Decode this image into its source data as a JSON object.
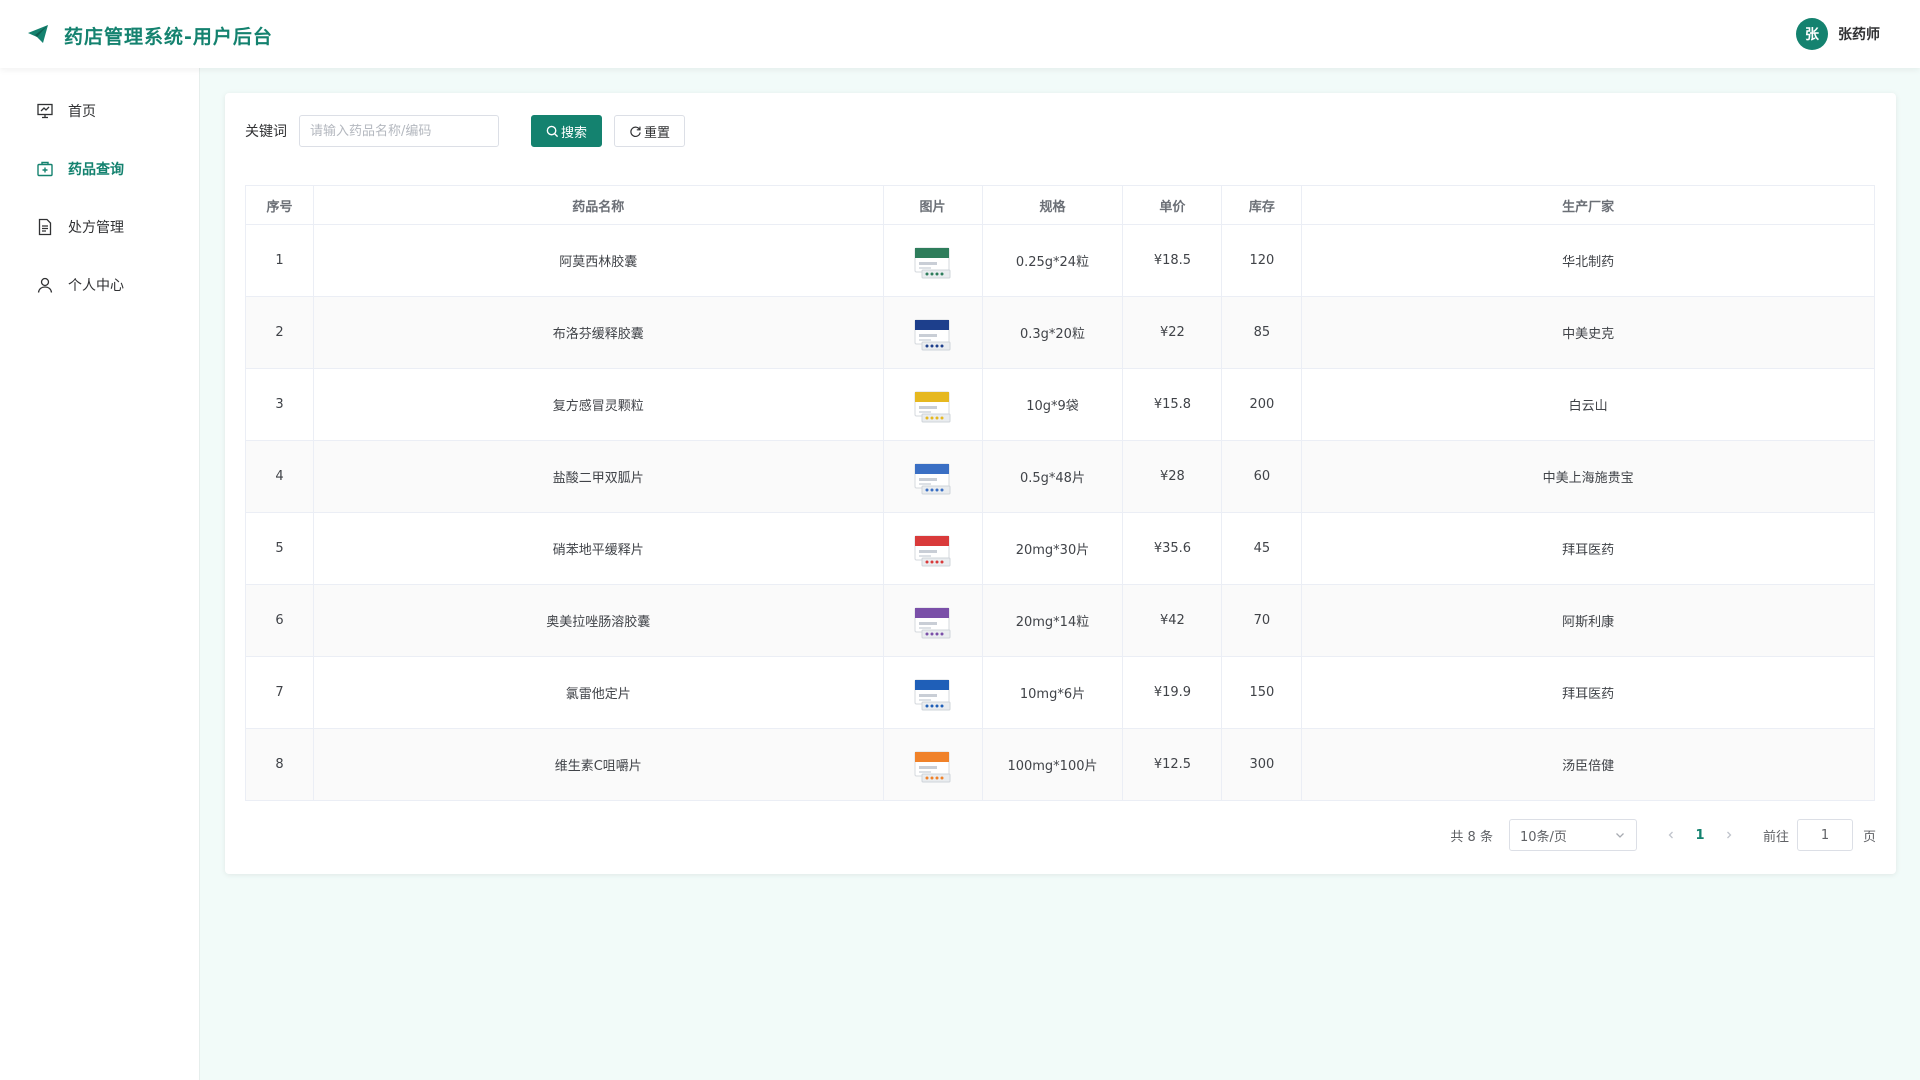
{
  "header": {
    "title": "药店管理系统-用户后台",
    "logo_icon": "paper-plane-icon",
    "user": {
      "avatar_text": "张",
      "name": "张药师"
    }
  },
  "sidebar": {
    "items": [
      {
        "label": "首页",
        "icon": "dashboard-icon",
        "active": false
      },
      {
        "label": "药品查询",
        "icon": "medicine-box-icon",
        "active": true
      },
      {
        "label": "处方管理",
        "icon": "document-icon",
        "active": false
      },
      {
        "label": "个人中心",
        "icon": "user-icon",
        "active": false
      }
    ]
  },
  "search": {
    "label": "关键词",
    "placeholder": "请输入药品名称/编码",
    "value": "",
    "search_button": "搜索",
    "reset_button": "重置"
  },
  "table": {
    "columns": [
      "序号",
      "药品名称",
      "图片",
      "规格",
      "单价",
      "库存",
      "生产厂家"
    ],
    "rows": [
      {
        "no": "1",
        "name": "阿莫西林胶囊",
        "spec": "0.25g*24粒",
        "price": "¥18.5",
        "stock": "120",
        "maker": "华北制药",
        "thumb_color": "#2e7d5b"
      },
      {
        "no": "2",
        "name": "布洛芬缓释胶囊",
        "spec": "0.3g*20粒",
        "price": "¥22",
        "stock": "85",
        "maker": "中美史克",
        "thumb_color": "#1d3f8c"
      },
      {
        "no": "3",
        "name": "复方感冒灵颗粒",
        "spec": "10g*9袋",
        "price": "¥15.8",
        "stock": "200",
        "maker": "白云山",
        "thumb_color": "#e6b820"
      },
      {
        "no": "4",
        "name": "盐酸二甲双胍片",
        "spec": "0.5g*48片",
        "price": "¥28",
        "stock": "60",
        "maker": "中美上海施贵宝",
        "thumb_color": "#3a6fc4"
      },
      {
        "no": "5",
        "name": "硝苯地平缓释片",
        "spec": "20mg*30片",
        "price": "¥35.6",
        "stock": "45",
        "maker": "拜耳医药",
        "thumb_color": "#d93a3a"
      },
      {
        "no": "6",
        "name": "奥美拉唑肠溶胶囊",
        "spec": "20mg*14粒",
        "price": "¥42",
        "stock": "70",
        "maker": "阿斯利康",
        "thumb_color": "#7a4fa8"
      },
      {
        "no": "7",
        "name": "氯雷他定片",
        "spec": "10mg*6片",
        "price": "¥19.9",
        "stock": "150",
        "maker": "拜耳医药",
        "thumb_color": "#1f5fb8"
      },
      {
        "no": "8",
        "name": "维生素C咀嚼片",
        "spec": "100mg*100片",
        "price": "¥12.5",
        "stock": "300",
        "maker": "汤臣倍健",
        "thumb_color": "#f0822a"
      }
    ]
  },
  "pagination": {
    "total_text": "共 8 条",
    "page_size": "10条/页",
    "current_page": "1",
    "goto_label": "前往",
    "goto_value": "1",
    "page_suffix": "页"
  },
  "colors": {
    "brand": "#14826f",
    "background": "#f2fbf9"
  }
}
